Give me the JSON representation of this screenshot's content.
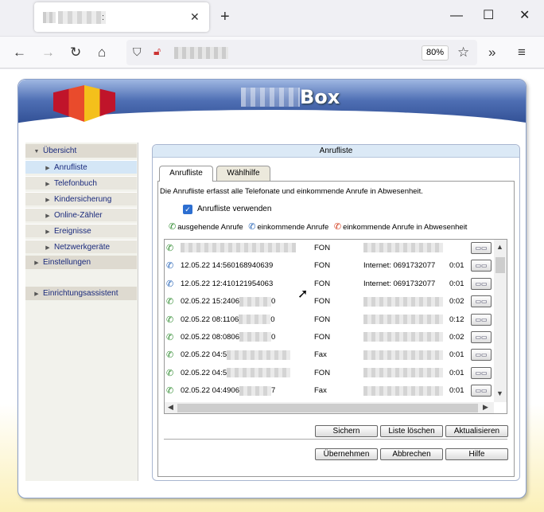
{
  "browser": {
    "tab_title": ":",
    "zoom": "80%"
  },
  "app": {
    "brand": "Box"
  },
  "sidebar": {
    "items": [
      {
        "label": "Übersicht"
      },
      {
        "label": "Anrufliste"
      },
      {
        "label": "Telefonbuch"
      },
      {
        "label": "Kindersicherung"
      },
      {
        "label": "Online-Zähler"
      },
      {
        "label": "Ereignisse"
      },
      {
        "label": "Netzwerkgeräte"
      },
      {
        "label": "Einstellungen"
      },
      {
        "label": "Einrichtungsassistent"
      }
    ]
  },
  "panel": {
    "title": "Anrufliste",
    "tabs": [
      {
        "label": "Anrufliste"
      },
      {
        "label": "Wählhilfe"
      }
    ],
    "description": "Die Anrufliste erfasst alle Telefonate und einkommende Anrufe in Abwesenheit.",
    "checkbox_label": "Anrufliste verwenden",
    "checkbox_checked": true,
    "legend": {
      "outgoing": "ausgehende Anrufe",
      "incoming": "einkommende Anrufe",
      "missed": "einkommende Anrufe in Abwesenheit"
    },
    "calls": [
      {
        "type": "outgoing",
        "datetime": "",
        "device": "FON",
        "extension": "",
        "duration": ""
      },
      {
        "type": "incoming",
        "datetime": "12.05.22 14:56",
        "number": "0168940639",
        "device": "FON",
        "extension": "Internet: 0691732077",
        "duration": "0:01"
      },
      {
        "type": "incoming",
        "datetime": "12.05.22 12:41",
        "number": "0121954063",
        "device": "FON",
        "extension": "Internet: 0691732077",
        "duration": "0:01"
      },
      {
        "type": "outgoing",
        "datetime": "02.05.22 15:24",
        "number": "06",
        "number_end": "0",
        "device": "FON",
        "extension": "",
        "duration": "0:02"
      },
      {
        "type": "outgoing",
        "datetime": "02.05.22 08:11",
        "number": "06",
        "number_end": "0",
        "device": "FON",
        "extension": "",
        "duration": "0:12"
      },
      {
        "type": "outgoing",
        "datetime": "02.05.22 08:08",
        "number": "06",
        "number_end": "0",
        "device": "FON",
        "extension": "",
        "duration": "0:02"
      },
      {
        "type": "outgoing",
        "datetime": "02.05.22 04:5",
        "number": "",
        "number_end": "",
        "device": "Fax",
        "extension": "",
        "duration": "0:01"
      },
      {
        "type": "outgoing",
        "datetime": "02.05.22 04:5",
        "number": "",
        "number_end": "",
        "device": "FON",
        "extension": "",
        "duration": "0:01"
      },
      {
        "type": "outgoing",
        "datetime": "02.05.22 04:49",
        "number": "06",
        "number_end": "7",
        "device": "Fax",
        "extension": "",
        "duration": "0:01"
      }
    ],
    "buttons": {
      "save": "Sichern",
      "clear": "Liste löschen",
      "refresh": "Aktualisieren",
      "apply": "Übernehmen",
      "cancel": "Abbrechen",
      "help": "Hilfe"
    }
  }
}
